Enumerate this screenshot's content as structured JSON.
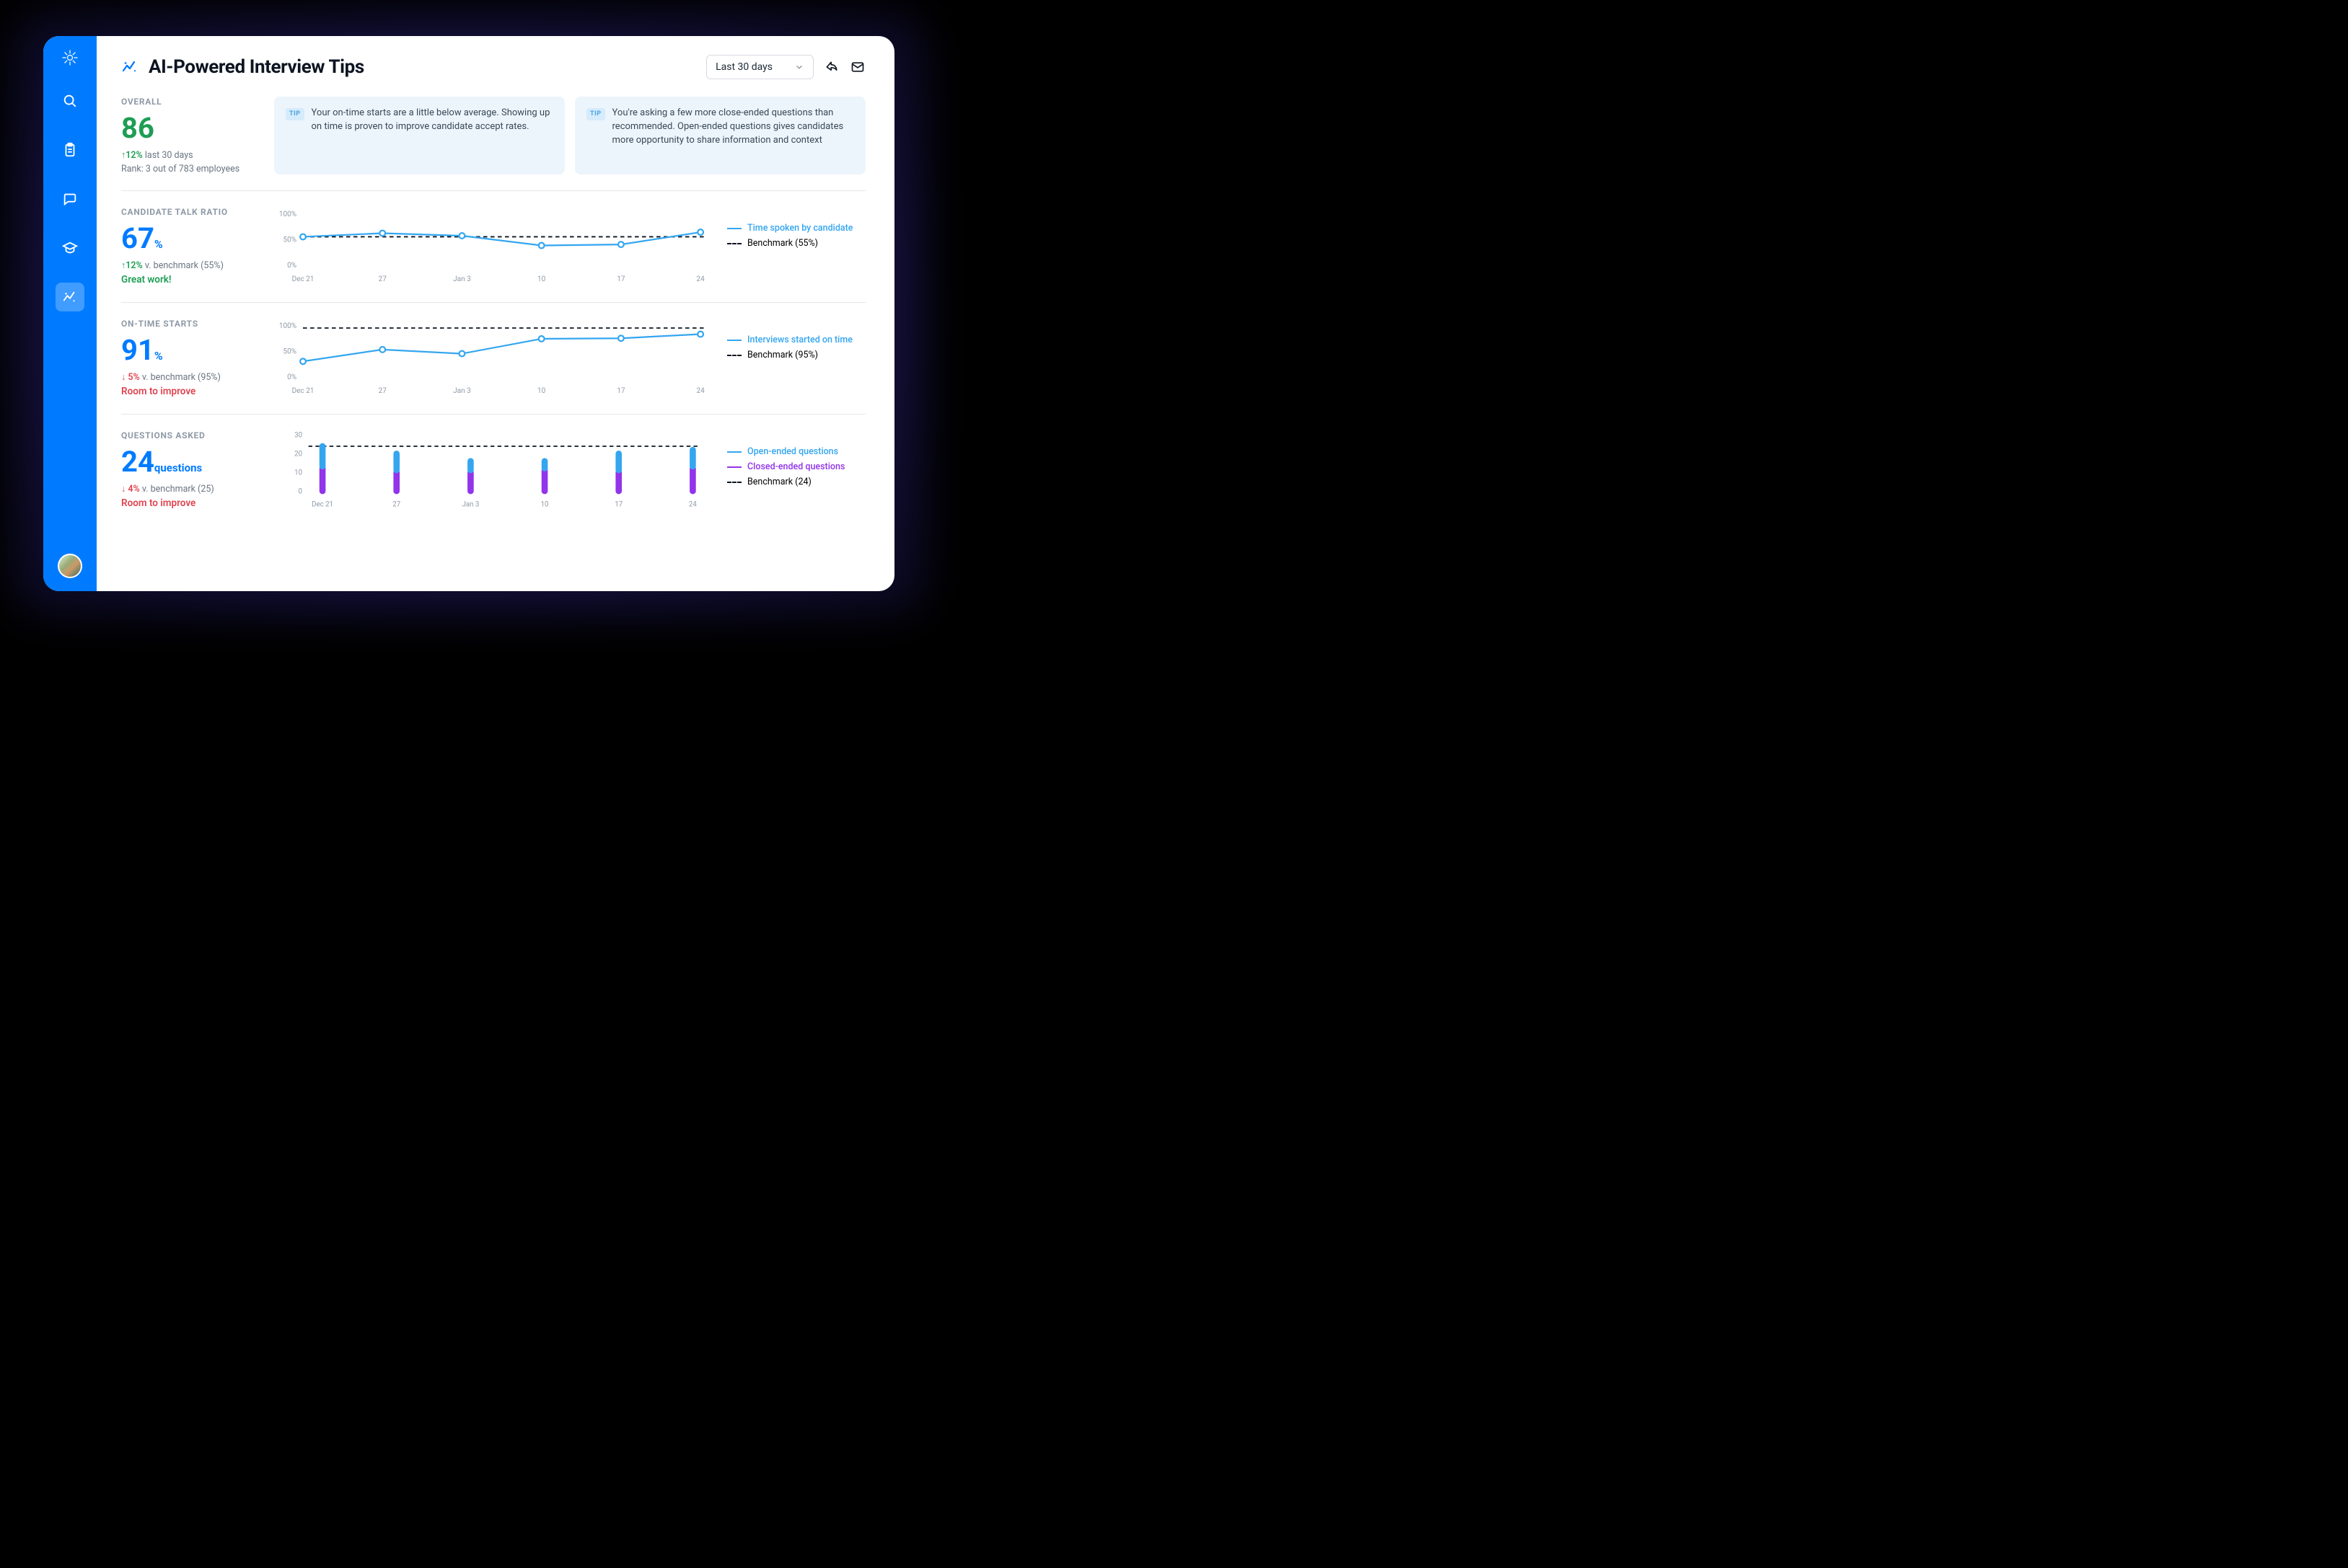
{
  "header": {
    "title": "AI-Powered Interview Tips",
    "dropdown_label": "Last 30 days"
  },
  "overall": {
    "label": "OVERALL",
    "score": "86",
    "delta_pct": "12%",
    "delta_suffix": "last 30 days",
    "rank": "Rank: 3 out of 783 employees"
  },
  "tips": {
    "badge": "TIP",
    "tip1": "Your on-time starts are a little below average. Showing up on time is proven to improve candidate accept rates.",
    "tip2": "You're asking a few more close-ended questions than recommended. Open-ended questions gives candidates more opportunity to share information and context"
  },
  "talk_ratio": {
    "label": "CANDIDATE TALK RATIO",
    "value": "67",
    "unit": "%",
    "delta_pct": "12%",
    "bench_text": "v. benchmark (55%)",
    "status": "Great work!",
    "legend_series": "Time spoken by candidate",
    "legend_bench": "Benchmark (55%)"
  },
  "ontime": {
    "label": "ON-TIME STARTS",
    "value": "91",
    "unit": "%",
    "delta_pct": "5%",
    "bench_text": "v. benchmark (95%)",
    "status": "Room to improve",
    "legend_series": "Interviews started on time",
    "legend_bench": "Benchmark (95%)"
  },
  "questions": {
    "label": "QUESTIONS ASKED",
    "value": "24",
    "unit": "questions",
    "delta_pct": "4%",
    "bench_text": "v. benchmark (25)",
    "status": "Room to improve",
    "legend_open": "Open-ended questions",
    "legend_closed": "Closed-ended questions",
    "legend_bench": "Benchmark (24)"
  },
  "x_ticks": [
    "Dec 21",
    "27",
    "Jan 3",
    "10",
    "17",
    "24"
  ],
  "chart_data": [
    {
      "type": "line",
      "title": "Candidate Talk Ratio",
      "xlabel": "",
      "ylabel": "",
      "ylim": [
        0,
        100
      ],
      "y_ticks": [
        0,
        50,
        100
      ],
      "benchmark": 55,
      "categories": [
        "Dec 21",
        "27",
        "Jan 3",
        "10",
        "17",
        "24"
      ],
      "series": [
        {
          "name": "Time spoken by candidate",
          "values": [
            55,
            62,
            57,
            38,
            40,
            64
          ]
        }
      ]
    },
    {
      "type": "line",
      "title": "On-Time Starts",
      "xlabel": "",
      "ylabel": "",
      "ylim": [
        0,
        100
      ],
      "y_ticks": [
        0,
        50,
        100
      ],
      "benchmark": 95,
      "categories": [
        "Dec 21",
        "27",
        "Jan 3",
        "10",
        "17",
        "24"
      ],
      "series": [
        {
          "name": "Interviews started on time",
          "values": [
            30,
            53,
            45,
            74,
            75,
            83
          ]
        }
      ]
    },
    {
      "type": "bar",
      "title": "Questions Asked",
      "xlabel": "",
      "ylabel": "",
      "ylim": [
        0,
        30
      ],
      "y_ticks": [
        0,
        10,
        20,
        30
      ],
      "benchmark": 24,
      "categories": [
        "Dec 21",
        "27",
        "Jan 3",
        "10",
        "17",
        "24"
      ],
      "series": [
        {
          "name": "Open-ended questions",
          "values": [
            12,
            10,
            6,
            5,
            10,
            10
          ]
        },
        {
          "name": "Closed-ended questions",
          "values": [
            12,
            10,
            10,
            11,
            10,
            12
          ]
        }
      ]
    }
  ]
}
